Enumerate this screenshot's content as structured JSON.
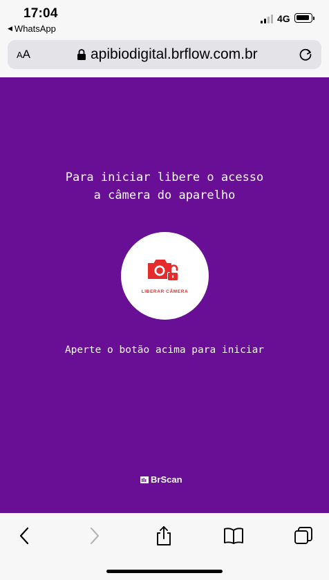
{
  "status_bar": {
    "time": "17:04",
    "back_app": "WhatsApp",
    "network": "4G"
  },
  "address_bar": {
    "text_size_label": "AA",
    "url": "apibiodigital.brflow.com.br"
  },
  "page": {
    "headline": "Para iniciar libere o acesso a câmera do aparelho",
    "camera_button_label": "LIBERAR CÂMERA",
    "instruction": "Aperte o botão acima para iniciar",
    "brand": "BrScan"
  },
  "colors": {
    "background": "#680f95",
    "button_accent": "#e52b2b",
    "button_bg": "#ffffff"
  },
  "icons": {
    "status": [
      "signal-icon",
      "battery-icon"
    ],
    "address": [
      "lock-icon",
      "reload-icon"
    ],
    "content": [
      "camera-unlock-icon",
      "brscan-logo-icon"
    ],
    "toolbar": [
      "back-icon",
      "forward-icon",
      "share-icon",
      "bookmarks-icon",
      "tabs-icon"
    ]
  }
}
